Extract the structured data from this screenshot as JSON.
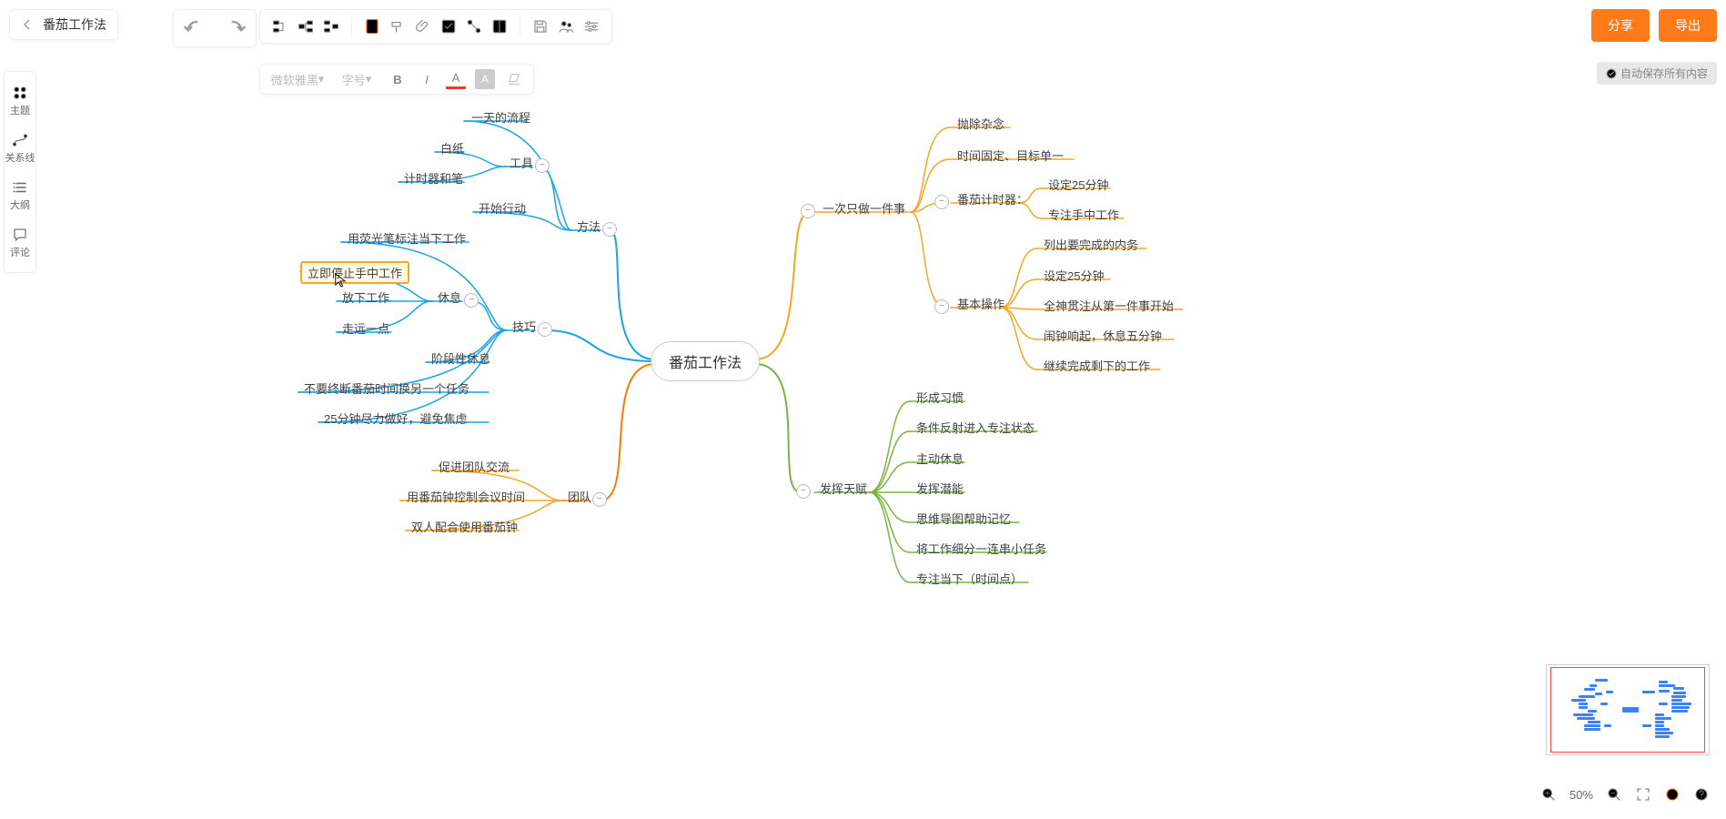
{
  "doc_title": "番茄工作法",
  "share_label": "分享",
  "export_label": "导出",
  "autosave_label": "自动保存所有内容",
  "left_panel": {
    "theme": "主题",
    "relation": "关系线",
    "outline": "大纲",
    "comment": "评论"
  },
  "format": {
    "font": "微软雅黑",
    "size": "字号"
  },
  "zoom": {
    "level": "50%"
  },
  "mindmap": {
    "center": "番茄工作法",
    "left_branches": [
      {
        "label": "方法",
        "color": "#1aa3e8",
        "children": [
          {
            "label": "一天的流程"
          },
          {
            "label": "工具",
            "children": [
              {
                "label": "白纸"
              },
              {
                "label": "计时器和笔"
              }
            ]
          },
          {
            "label": "开始行动"
          }
        ]
      },
      {
        "label": "技巧",
        "color": "#1aa3e8",
        "children": [
          {
            "label": "用荧光笔标注当下工作"
          },
          {
            "label": "休息",
            "children": [
              {
                "label": "立即停止手中工作",
                "selected": true
              },
              {
                "label": "放下工作"
              },
              {
                "label": "走远一点"
              }
            ]
          },
          {
            "label": "阶段性休息"
          },
          {
            "label": "不要终断番茄时间换另一个任务"
          },
          {
            "label": "25分钟尽力做好，避免焦虑"
          }
        ]
      },
      {
        "label": "团队",
        "color": "#f57c00",
        "children": [
          {
            "label": "促进团队交流"
          },
          {
            "label": "用番茄钟控制会议时间"
          },
          {
            "label": "双人配合使用番茄钟"
          }
        ]
      }
    ],
    "right_branches": [
      {
        "label": "一次只做一件事",
        "color": "#f5a623",
        "children": [
          {
            "label": "抛除杂念"
          },
          {
            "label": "时间固定、目标单一"
          },
          {
            "label": "番茄计时器：",
            "children": [
              {
                "label": "设定25分钟"
              },
              {
                "label": "专注手中工作"
              }
            ]
          },
          {
            "label": "基本操作",
            "children": [
              {
                "label": "列出要完成的内务"
              },
              {
                "label": "设定25分钟"
              },
              {
                "label": "全神贯注从第一件事开始"
              },
              {
                "label": "闹钟响起，休息五分钟"
              },
              {
                "label": "继续完成剩下的工作"
              }
            ]
          }
        ]
      },
      {
        "label": "发挥天赋",
        "color": "#7cb342",
        "children": [
          {
            "label": "形成习惯"
          },
          {
            "label": "条件反射进入专注状态"
          },
          {
            "label": "主动休息"
          },
          {
            "label": "发挥潜能"
          },
          {
            "label": "思维导图帮助记忆"
          },
          {
            "label": "将工作细分一连串小任务"
          },
          {
            "label": "专注当下（时间点）"
          }
        ]
      }
    ]
  }
}
